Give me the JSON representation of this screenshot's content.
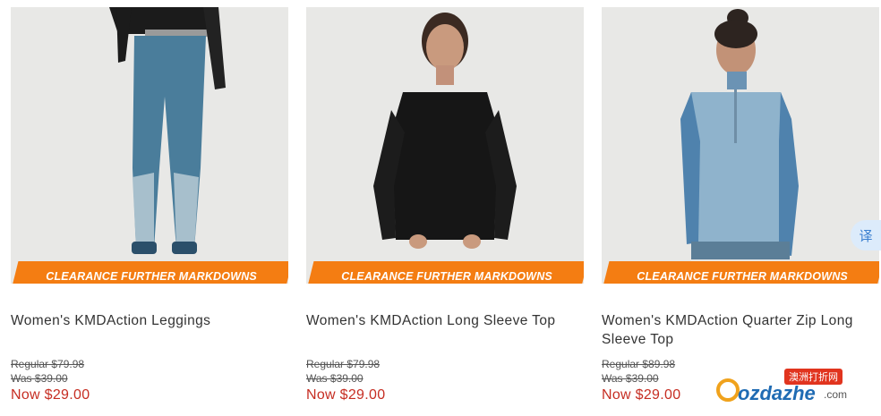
{
  "products": [
    {
      "badge": "CLEARANCE FURTHER MARKDOWNS",
      "title": "Women's KMDAction Leggings",
      "regular": "Regular $79.98",
      "was": "Was $39.00",
      "now": "Now $29.00"
    },
    {
      "badge": "CLEARANCE FURTHER MARKDOWNS",
      "title": "Women's KMDAction Long Sleeve Top",
      "regular": "Regular $79.98",
      "was": "Was $39.00",
      "now": "Now $29.00"
    },
    {
      "badge": "CLEARANCE FURTHER MARKDOWNS",
      "title": "Women's KMDAction Quarter Zip Long Sleeve Top",
      "regular": "Regular $89.98",
      "was": "Was $39.00",
      "now": "Now $29.00"
    }
  ],
  "translate": {
    "label": "译"
  },
  "watermark": {
    "tag": "澳洲打折网",
    "word": "ozdazhe",
    "suffix": ".com"
  },
  "colors": {
    "badge": "#f47d12",
    "now_price": "#c62d22"
  }
}
